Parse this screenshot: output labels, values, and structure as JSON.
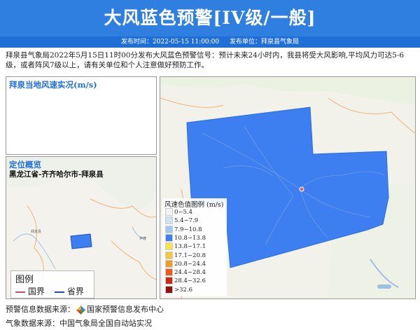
{
  "header": {
    "title": "大风蓝色预警[IV级/一般]",
    "publish_time_label": "发布时间：2022-05-15 11:00:00",
    "publisher_label": "发布单位：拜泉县气象局"
  },
  "description": "拜泉县气象局2022年5月15日11时00分发布大风蓝色预警信号：预计未来24小时内，我县将受大风影响,平均风力可达5-6级，或者阵风7级以上，请有关单位和个人注意做好预防工作。",
  "wind_panel": {
    "title": "拜泉当地风速实况(m/s)"
  },
  "location_panel": {
    "title": "定位概览",
    "path": "黑龙江省-齐齐哈尔市-拜泉县",
    "legend_title": "图例",
    "legend_items": [
      "国界",
      "省界"
    ],
    "map_labels": [
      "拜泉县",
      "伊春"
    ]
  },
  "main_map": {
    "fill_color": "#3d7ff0",
    "colorbar_title": "风速色值图例 (m/s)",
    "colorbar_items": [
      {
        "label": "0~5.4",
        "color": "#f2f2f2"
      },
      {
        "label": "5.4~7.9",
        "color": "#cfe3f7"
      },
      {
        "label": "7.9~10.8",
        "color": "#9fc8f2"
      },
      {
        "label": "10.8~13.8",
        "color": "#3d7ff0"
      },
      {
        "label": "13.8~17.1",
        "color": "#f7e34a"
      },
      {
        "label": "17.1~20.8",
        "color": "#f7c73a"
      },
      {
        "label": "20.8~24.4",
        "color": "#f29a2a"
      },
      {
        "label": "24.4~28.4",
        "color": "#ec5a1e"
      },
      {
        "label": "28.4~32.6",
        "color": "#cc2a16"
      },
      {
        "label": ">32.6",
        "color": "#8f120e"
      }
    ]
  },
  "sources": {
    "warning_source_label": "预警信息数据来源：",
    "warning_source": "国家预警信息发布中心",
    "weather_source": "气象数据来源：中国气象局全国自动站实况"
  },
  "colors": {
    "header_bg": "#2e7fe0",
    "subbar_bg": "#1f6fd6",
    "accent": "#1f6fd6",
    "national_border": "#c0506a",
    "province_border": "#1f4fbf"
  }
}
